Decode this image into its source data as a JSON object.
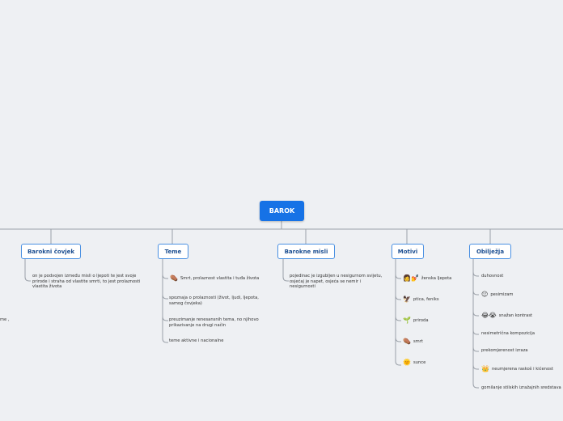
{
  "root": {
    "label": "BAROK"
  },
  "branches": [
    {
      "label": "Barokni čovjek",
      "children": [
        {
          "text": "on je podvojen između misli o ljepoti te jest svoje prirode i straha od vlastite smrti, to jest prolaznosti vlastita života"
        }
      ]
    },
    {
      "label": "Teme",
      "children": [
        {
          "icon": "⚰️",
          "text": "Smrt, prolaznost vlastita i tuđa života"
        },
        {
          "text": "spoznaja o prolaznosti (život, ljudi, ljepota, samog čovjeka)"
        },
        {
          "text": "preuzimanje renesansnih tema, no njihovo prikazivanje na drugi način"
        },
        {
          "text": "teme aktivne i nacionalne"
        }
      ]
    },
    {
      "label": "Barokne misli",
      "children": [
        {
          "text": "pojedinac je izgubljen u nesigurnom svijetu, osjećaj je napet, osjeća se nemir i nesigurnosti"
        }
      ]
    },
    {
      "label": "Motivi",
      "children": [
        {
          "icon": "👩💅",
          "text": "ženska ljepota"
        },
        {
          "icon": "🦅",
          "text": "ptica, feniks"
        },
        {
          "icon": "🌱",
          "text": "priroda"
        },
        {
          "icon": "⚰️",
          "text": "smrt"
        },
        {
          "icon": "🌞",
          "text": "sunce"
        }
      ]
    },
    {
      "label": "Obilježja",
      "children": [
        {
          "text": "duhovnost"
        },
        {
          "icon": "😐",
          "text": "pesimizam"
        },
        {
          "icon": "😂😭",
          "text": "snažan kontrast"
        },
        {
          "text": "nesimetrična kompozicija"
        },
        {
          "text": "prekomjerenost izraza"
        },
        {
          "icon": "👑",
          "text": "neumjerena raskoš i kićenost"
        },
        {
          "text": "gomilanje stilskih izražajnih sredstava"
        }
      ]
    }
  ],
  "clipped_left": {
    "text": "me ,"
  }
}
